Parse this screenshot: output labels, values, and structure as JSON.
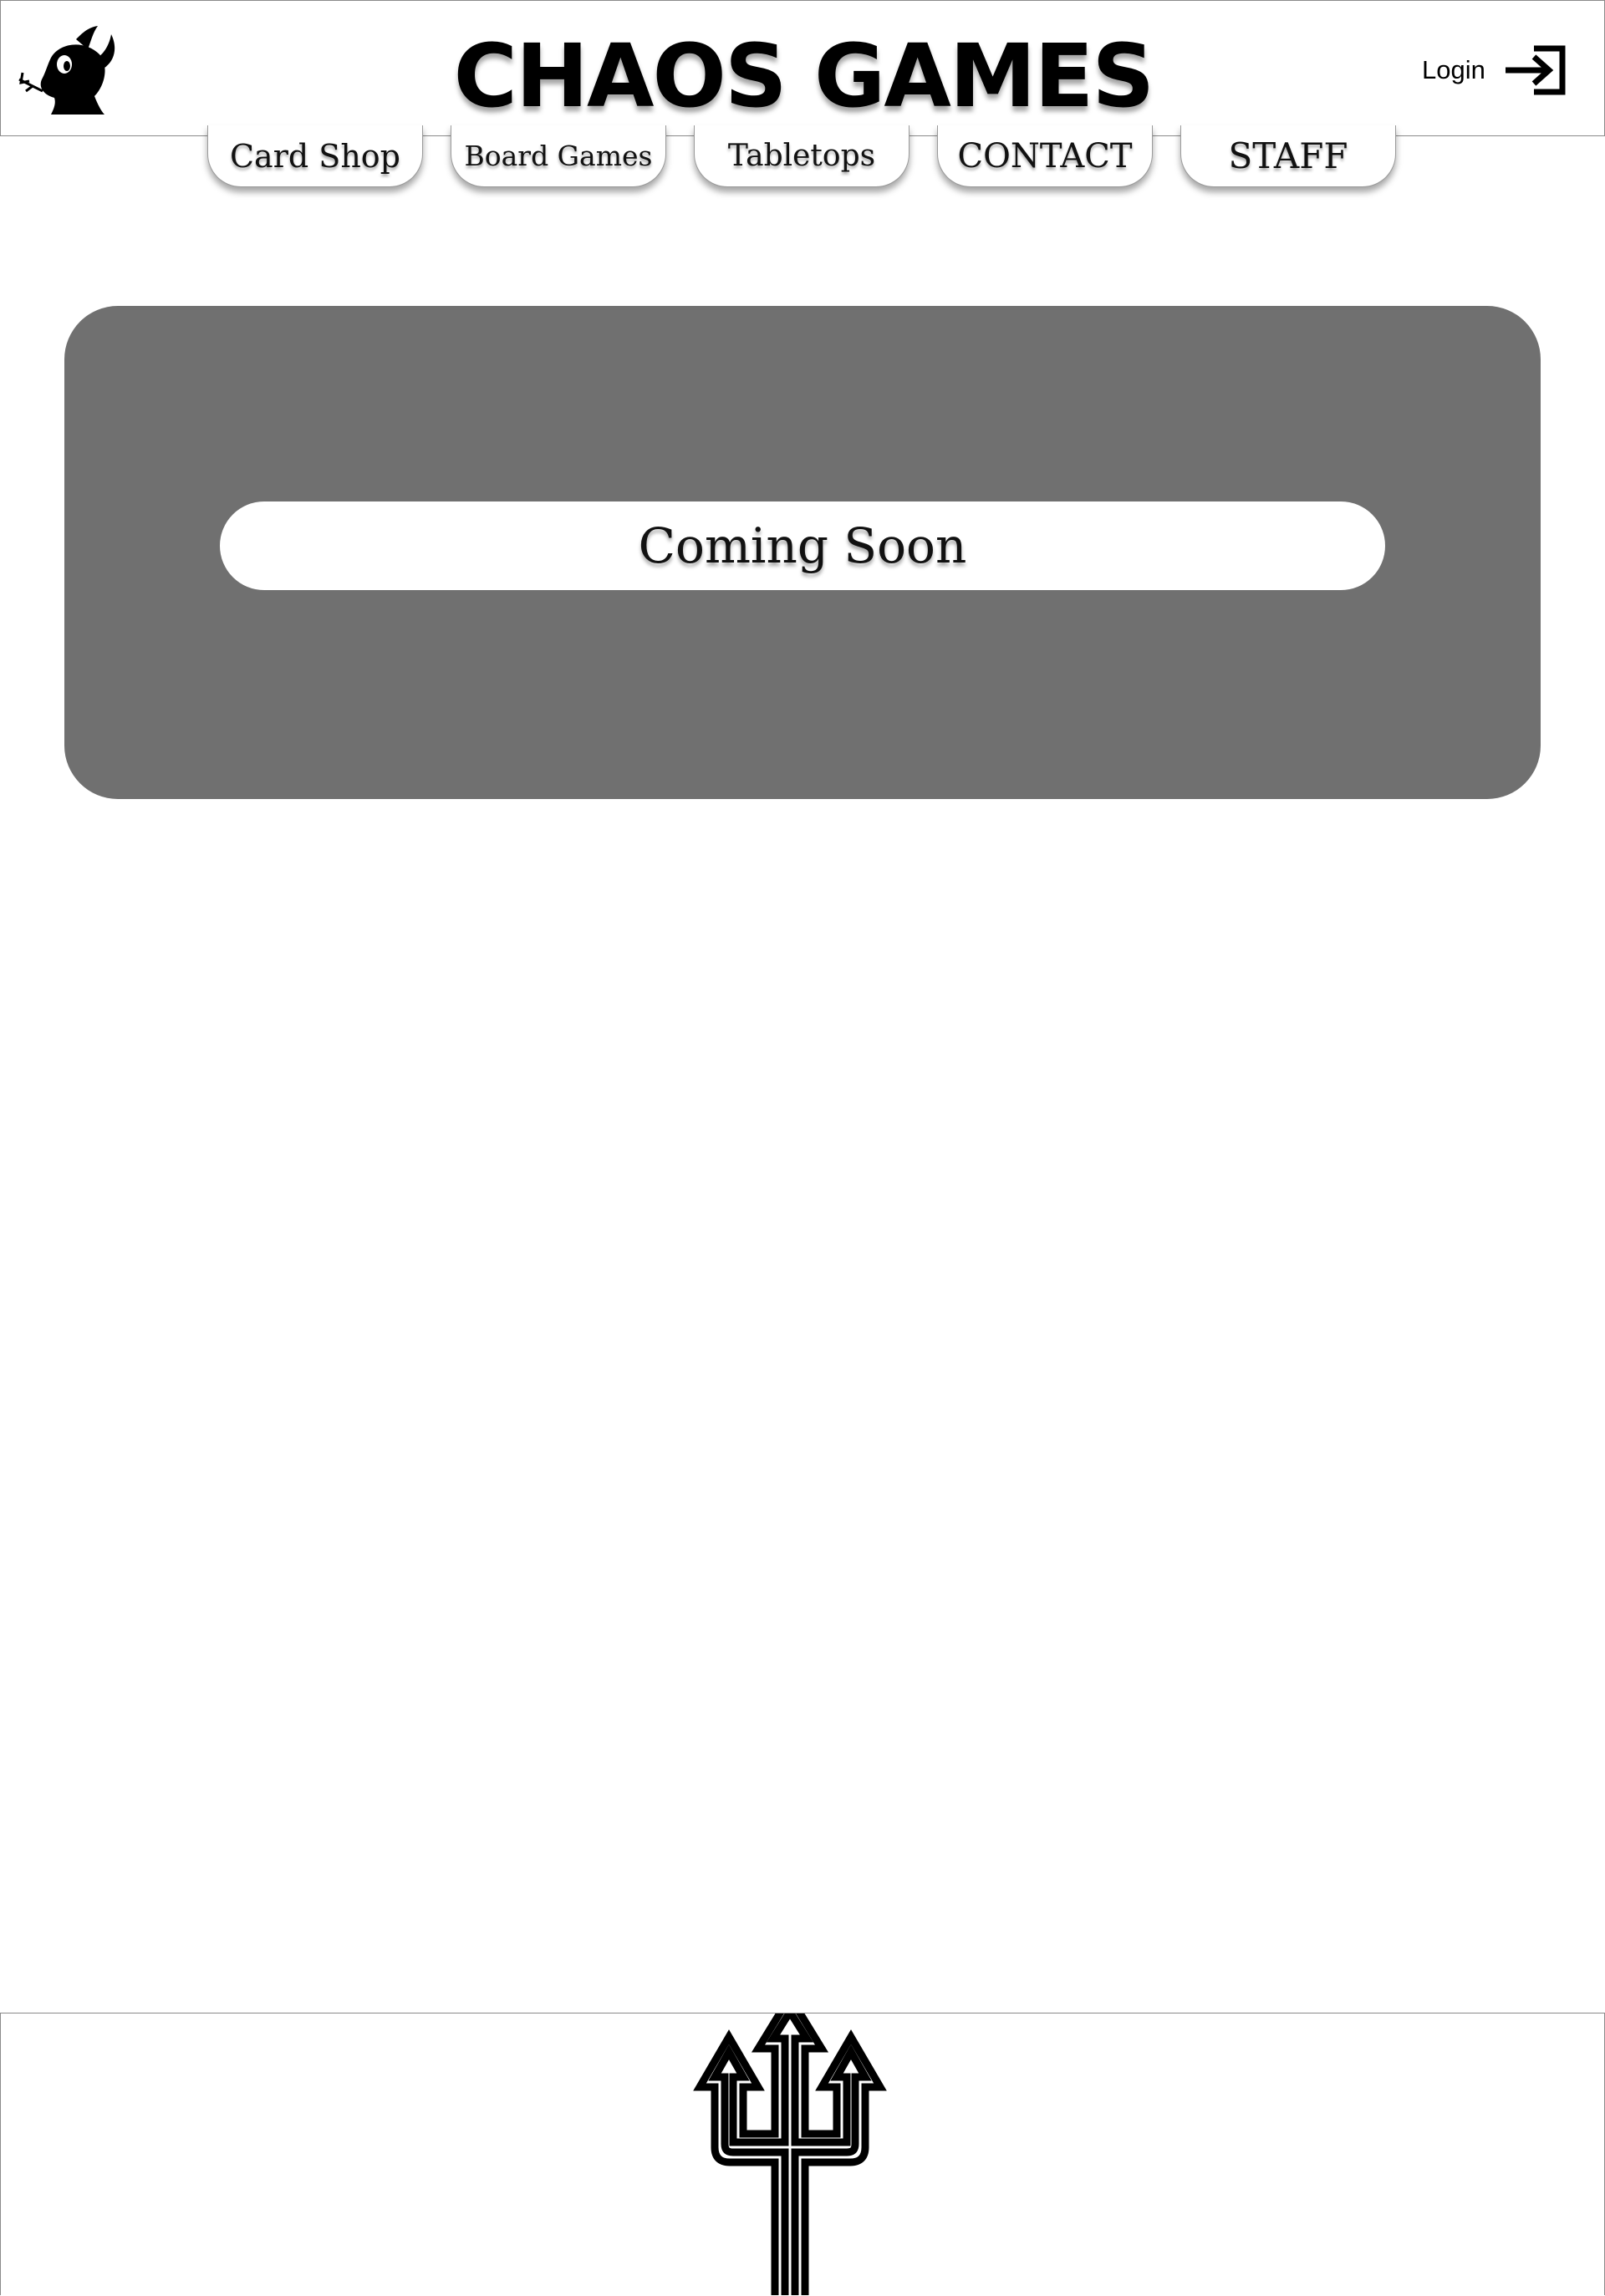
{
  "header": {
    "title": "CHAOS GAMES",
    "logo_icon": "devil-head-icon",
    "login_label": "Login",
    "login_icon": "login-arrow-icon"
  },
  "nav": {
    "items": [
      {
        "label": "Card Shop"
      },
      {
        "label": "Board Games"
      },
      {
        "label": "Tabletops"
      },
      {
        "label": "CONTACT"
      },
      {
        "label": "STAFF"
      }
    ]
  },
  "main": {
    "status_text": "Coming Soon",
    "panel_color": "#707070"
  },
  "footer": {
    "icon": "trident-icon"
  }
}
